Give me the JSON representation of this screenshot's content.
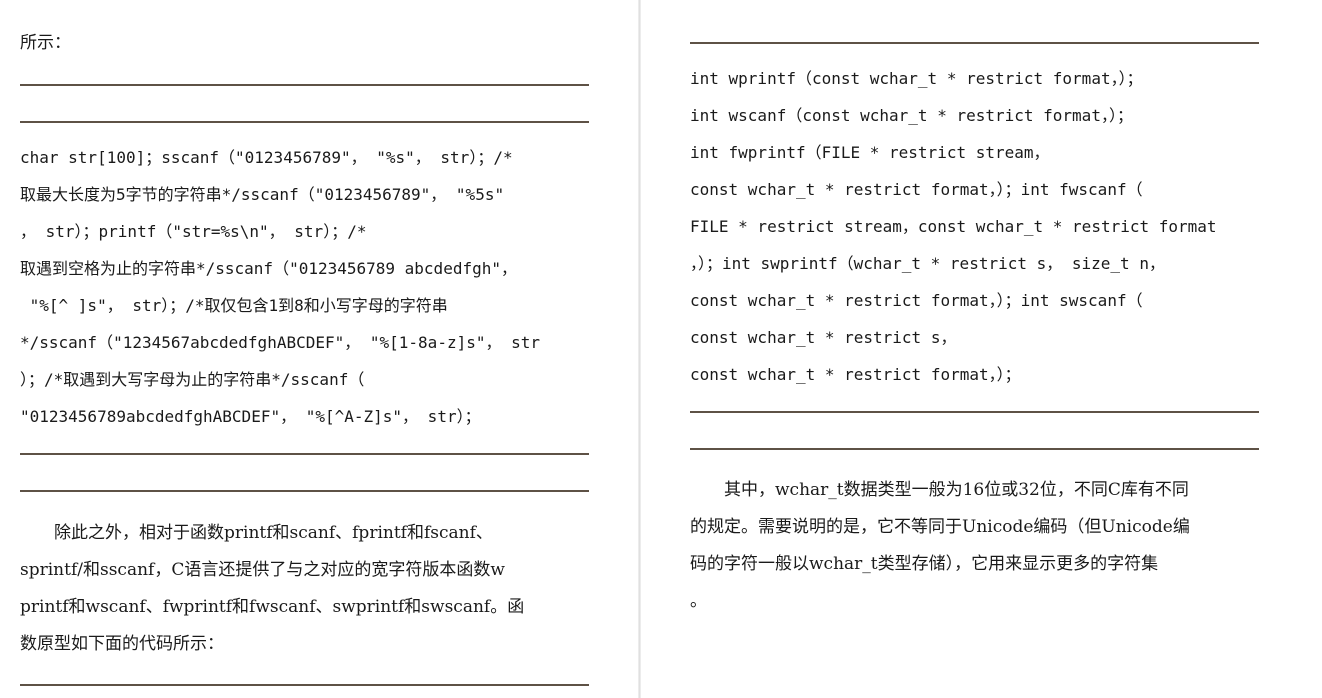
{
  "left_page": {
    "intro_tail": "所示：",
    "code_lines": [
      "char str[100]；sscanf（\"0123456789\"， \"%s\"， str）；/*",
      "取最大长度为5字节的字符串*/sscanf（\"0123456789\"， \"%5s\"",
      "， str）；printf（\"str=%s\\n\"， str）；/*",
      "取遇到空格为止的字符串*/sscanf（\"0123456789 abcdedfgh\"，",
      " \"%[^ ]s\"， str）；/*取仅包含1到8和小写字母的字符串",
      "*/sscanf（\"1234567abcdedfghABCDEF\"， \"%[1-8a-z]s\"， str",
      "）；/*取遇到大写字母为止的字符串*/sscanf（",
      "\"0123456789abcdedfghABCDEF\"， \"%[^A-Z]s\"， str）；"
    ],
    "paragraph_lines": [
      "　　除此之外，相对于函数printf和scanf、fprintf和fscanf、",
      "sprintf/和sscanf，C语言还提供了与之对应的宽字符版本函数w",
      "printf和wscanf、fwprintf和fwscanf、swprintf和swscanf。函",
      "数原型如下面的代码所示："
    ]
  },
  "right_page": {
    "code_lines": [
      "int wprintf（const wchar_t * restrict format，）；",
      "int wscanf（const wchar_t * restrict format，）；",
      "int fwprintf（FILE * restrict stream，",
      "const wchar_t * restrict format，）；int fwscanf（",
      "FILE * restrict stream，const wchar_t * restrict format",
      "，）；int swprintf（wchar_t * restrict s， size_t n，",
      "const wchar_t * restrict format，）；int swscanf（",
      "const wchar_t * restrict s，",
      "const wchar_t * restrict format，）；"
    ],
    "paragraph_lines": [
      "　　其中，wchar_t数据类型一般为16位或32位，不同C库有不同",
      "的规定。需要说明的是，它不等同于Unicode编码（但Unicode编",
      "码的字符一般以wchar_t类型存储），它用来显示更多的字符集",
      "。"
    ]
  }
}
